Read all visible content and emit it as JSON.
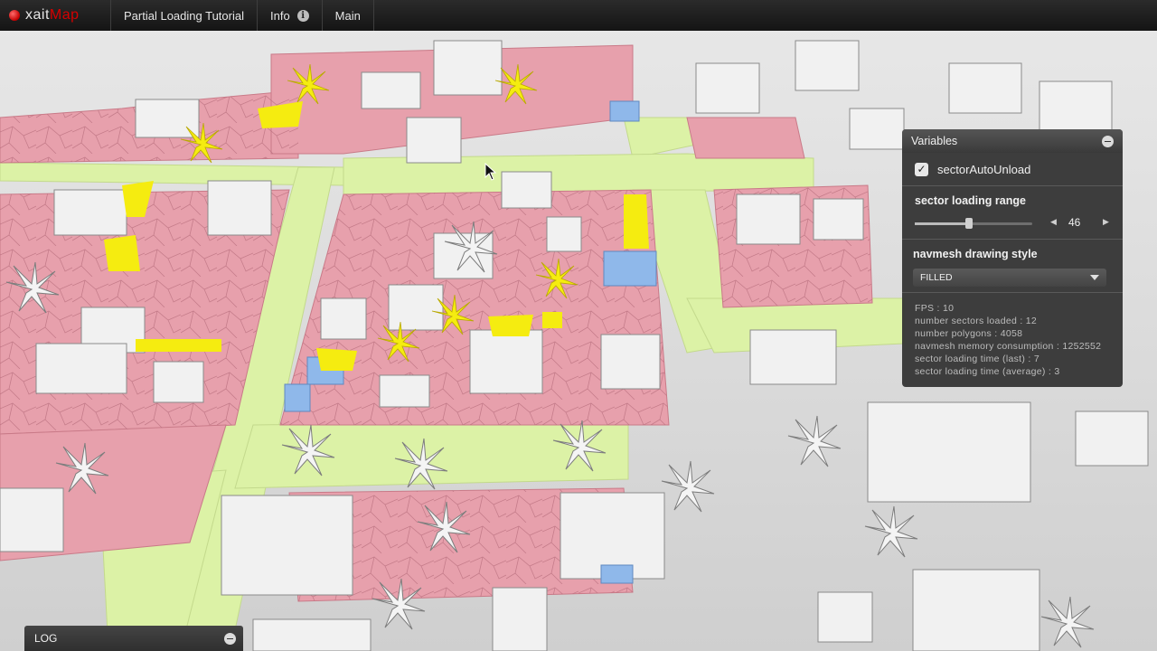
{
  "app": {
    "logo_prefix": "xait",
    "logo_suffix": "Map",
    "colors": {
      "brand_red": "#d60000",
      "navmesh_red": "#e7a0ac",
      "navmesh_green": "#dcf2a6",
      "highlight_yellow": "#f5ec10",
      "water_blue": "#8fb8ea"
    }
  },
  "menu": {
    "items": [
      {
        "label": "Partial Loading Tutorial"
      },
      {
        "label": "Info",
        "icon": "info-icon"
      },
      {
        "label": "Main"
      }
    ]
  },
  "variables_panel": {
    "title": "Variables",
    "checkbox": {
      "label": "sectorAutoUnload",
      "checked": true
    },
    "range": {
      "label": "sector loading range",
      "value": "46",
      "fraction": 0.46
    },
    "drawing_style": {
      "label": "navmesh drawing style",
      "selected": "FILLED"
    },
    "stats": [
      "FPS : 10",
      "number sectors loaded : 12",
      "number polygons : 4058",
      "navmesh memory consumption : 1252552",
      "sector loading time (last) : 7",
      "sector loading time (average) : 3"
    ]
  },
  "log": {
    "title": "LOG"
  }
}
